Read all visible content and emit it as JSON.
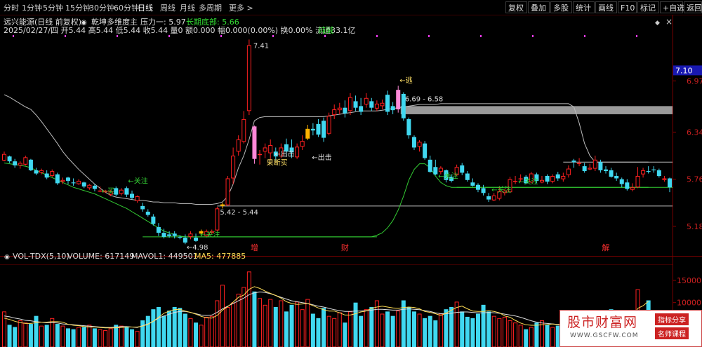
{
  "toolbar": {
    "periods": [
      "分时",
      "1分钟",
      "5分钟",
      "15分钟",
      "30分钟",
      "60分钟",
      "日线",
      "周线",
      "月线",
      "多周期",
      "更多 >"
    ],
    "active_period": "日线",
    "right_buttons": [
      "复权",
      "叠加",
      "多股",
      "统计",
      "画线",
      "F10",
      "标记",
      "+自选",
      "返回"
    ]
  },
  "info": {
    "title": "远兴能源(日线 前复权)",
    "indicator": "乾坤多维度主",
    "pressure_label": "压力一: 5.97",
    "bottom_label": "长期底部: 5.66",
    "quote": "2025/02/27/四 开5.44 高5.44 低5.44 收5.44 量0 额0.000 幅0.000(0.00%) 换0.00% 流通33.1亿",
    "tag": "纯碱"
  },
  "vol_header": {
    "name": "VOL-TDX(5,10)",
    "volume": "VOLUME: 617149",
    "mavol1": "MAVOL1: 449501",
    "ma5": "MA5: 477885"
  },
  "chart_data": {
    "type": "candlestick",
    "price_axis_ticks": [
      "7.10",
      "6.97",
      "6.34",
      "5.76",
      "5.18"
    ],
    "volume_axis_ticks": [
      "15000",
      "10000"
    ],
    "ylim": [
      4.98,
      7.44
    ],
    "candles": [
      [
        5.99,
        6.07,
        6.1,
        5.98
      ],
      [
        6.04,
        5.98,
        6.05,
        5.96
      ],
      [
        5.98,
        5.93,
        6.01,
        5.9
      ],
      [
        5.93,
        5.96,
        5.98,
        5.89
      ],
      [
        5.94,
        6.03,
        6.05,
        5.93
      ],
      [
        6.0,
        5.87,
        6.01,
        5.86
      ],
      [
        5.87,
        5.83,
        5.9,
        5.81
      ],
      [
        5.84,
        5.87,
        5.89,
        5.82
      ],
      [
        5.83,
        5.78,
        5.87,
        5.76
      ],
      [
        5.8,
        5.86,
        5.88,
        5.79
      ],
      [
        5.82,
        5.71,
        5.84,
        5.69
      ],
      [
        5.73,
        5.75,
        5.78,
        5.7
      ],
      [
        5.78,
        5.74,
        5.79,
        5.7
      ],
      [
        5.72,
        5.71,
        5.77,
        5.68
      ],
      [
        5.7,
        5.74,
        5.76,
        5.69
      ],
      [
        5.72,
        5.67,
        5.73,
        5.65
      ],
      [
        5.65,
        5.69,
        5.7,
        5.63
      ],
      [
        5.68,
        5.64,
        5.7,
        5.61
      ],
      [
        5.62,
        5.62,
        5.67,
        5.6
      ],
      [
        5.6,
        5.62,
        5.63,
        5.59
      ],
      [
        5.57,
        5.61,
        5.63,
        5.55
      ],
      [
        5.65,
        5.57,
        5.67,
        5.55
      ],
      [
        5.58,
        5.63,
        5.65,
        5.56
      ],
      [
        5.65,
        5.57,
        5.67,
        5.54
      ],
      [
        5.58,
        5.53,
        5.62,
        5.51
      ],
      [
        5.49,
        5.55,
        5.56,
        5.47
      ],
      [
        5.43,
        5.39,
        5.47,
        5.36
      ],
      [
        5.36,
        5.32,
        5.39,
        5.3
      ],
      [
        5.3,
        5.21,
        5.33,
        5.19
      ],
      [
        5.17,
        5.1,
        5.22,
        5.06
      ],
      [
        5.1,
        5.05,
        5.15,
        5.03
      ],
      [
        5.08,
        5.06,
        5.12,
        5.04
      ],
      [
        5.09,
        5.06,
        5.12,
        5.03
      ],
      [
        5.05,
        5.04,
        5.07,
        5.02
      ],
      [
        5.04,
        4.98,
        5.08,
        4.96
      ],
      [
        5.05,
        5.09,
        5.12,
        5.02
      ],
      [
        5.04,
        5.0,
        5.09,
        4.99
      ],
      [
        5.09,
        5.12,
        5.14,
        5.06
      ],
      [
        5.06,
        5.12,
        5.14,
        5.05
      ],
      [
        5.1,
        5.12,
        5.14,
        5.08
      ],
      [
        5.13,
        5.4,
        5.42,
        5.12
      ],
      [
        5.43,
        5.45,
        5.47,
        5.4
      ],
      [
        5.44,
        5.77,
        5.8,
        5.43
      ],
      [
        5.77,
        6.05,
        6.15,
        5.7
      ],
      [
        6.1,
        6.25,
        6.3,
        6.05
      ],
      [
        6.22,
        6.5,
        6.6,
        6.2
      ],
      [
        6.6,
        7.41,
        7.48,
        6.55
      ],
      [
        6.41,
        6.01,
        6.42,
        5.95
      ],
      [
        6.06,
        6.07,
        6.12,
        5.94
      ],
      [
        6.1,
        6.15,
        6.2,
        6.02
      ],
      [
        6.08,
        6.18,
        6.25,
        6.0
      ],
      [
        6.1,
        6.04,
        6.15,
        5.99
      ],
      [
        6.04,
        6.15,
        6.2,
        6.02
      ],
      [
        6.19,
        6.1,
        6.26,
        6.05
      ],
      [
        6.15,
        6.09,
        6.25,
        6.02
      ],
      [
        6.03,
        6.16,
        6.2,
        6.01
      ],
      [
        6.16,
        6.23,
        6.3,
        6.12
      ],
      [
        6.26,
        6.38,
        6.43,
        6.24
      ],
      [
        6.38,
        6.36,
        6.45,
        6.3
      ],
      [
        6.44,
        6.31,
        6.5,
        6.28
      ],
      [
        6.48,
        6.27,
        6.52,
        6.22
      ],
      [
        6.32,
        6.54,
        6.58,
        6.3
      ],
      [
        6.55,
        6.62,
        6.68,
        6.5
      ],
      [
        6.61,
        6.64,
        6.7,
        6.56
      ],
      [
        6.64,
        6.57,
        6.73,
        6.52
      ],
      [
        6.6,
        6.77,
        6.82,
        6.55
      ],
      [
        6.72,
        6.64,
        6.79,
        6.6
      ],
      [
        6.66,
        6.59,
        6.76,
        6.55
      ],
      [
        6.68,
        6.76,
        6.82,
        6.64
      ],
      [
        6.72,
        6.64,
        6.76,
        6.6
      ],
      [
        6.63,
        6.69,
        6.73,
        6.6
      ],
      [
        6.66,
        6.7,
        6.74,
        6.62
      ],
      [
        6.8,
        6.59,
        6.85,
        6.55
      ],
      [
        6.66,
        6.61,
        6.71,
        6.56
      ],
      [
        6.62,
        6.86,
        6.91,
        6.58
      ],
      [
        6.81,
        6.51,
        6.83,
        6.48
      ],
      [
        6.5,
        6.3,
        6.52,
        6.26
      ],
      [
        6.28,
        6.15,
        6.3,
        6.12
      ],
      [
        6.16,
        6.22,
        6.24,
        6.1
      ],
      [
        6.2,
        6.02,
        6.23,
        6.0
      ],
      [
        6.0,
        5.85,
        6.05,
        5.84
      ],
      [
        5.91,
        5.82,
        6.0,
        5.81
      ],
      [
        5.85,
        5.9,
        5.92,
        5.82
      ],
      [
        5.87,
        5.75,
        5.88,
        5.72
      ],
      [
        5.79,
        5.74,
        5.82,
        5.72
      ],
      [
        5.81,
        5.91,
        5.94,
        5.8
      ],
      [
        5.93,
        5.84,
        5.96,
        5.81
      ],
      [
        5.83,
        5.75,
        5.86,
        5.73
      ],
      [
        5.72,
        5.68,
        5.77,
        5.67
      ],
      [
        5.69,
        5.63,
        5.71,
        5.6
      ],
      [
        5.65,
        5.59,
        5.69,
        5.56
      ],
      [
        5.55,
        5.51,
        5.59,
        5.48
      ],
      [
        5.5,
        5.56,
        5.59,
        5.49
      ],
      [
        5.52,
        5.61,
        5.67,
        5.5
      ],
      [
        5.59,
        5.62,
        5.64,
        5.56
      ],
      [
        5.6,
        5.76,
        5.79,
        5.59
      ],
      [
        5.73,
        5.74,
        5.8,
        5.7
      ],
      [
        5.77,
        5.77,
        5.82,
        5.73
      ],
      [
        5.79,
        5.71,
        5.81,
        5.7
      ],
      [
        5.72,
        5.83,
        5.85,
        5.71
      ],
      [
        5.82,
        5.74,
        5.84,
        5.71
      ],
      [
        5.72,
        5.75,
        5.8,
        5.71
      ],
      [
        5.8,
        5.73,
        5.82,
        5.7
      ],
      [
        5.73,
        5.8,
        5.82,
        5.71
      ],
      [
        5.82,
        5.77,
        5.85,
        5.74
      ],
      [
        5.76,
        5.8,
        5.84,
        5.73
      ],
      [
        5.81,
        5.89,
        5.93,
        5.78
      ],
      [
        5.99,
        5.97,
        6.01,
        5.9
      ],
      [
        5.95,
        5.96,
        6.02,
        5.92
      ],
      [
        5.92,
        5.86,
        5.96,
        5.84
      ],
      [
        5.88,
        5.9,
        5.95,
        5.87
      ],
      [
        5.89,
        6.0,
        6.05,
        5.86
      ],
      [
        5.97,
        5.87,
        6.0,
        5.84
      ],
      [
        5.88,
        5.86,
        5.92,
        5.83
      ],
      [
        5.87,
        5.79,
        5.9,
        5.78
      ],
      [
        5.8,
        5.77,
        5.84,
        5.74
      ],
      [
        5.76,
        5.7,
        5.78,
        5.66
      ],
      [
        5.72,
        5.64,
        5.76,
        5.62
      ],
      [
        5.63,
        5.66,
        5.71,
        5.61
      ],
      [
        5.66,
        5.8,
        5.91,
        5.65
      ],
      [
        5.82,
        5.87,
        5.9,
        5.78
      ],
      [
        5.86,
        5.85,
        5.92,
        5.83
      ],
      [
        5.88,
        5.87,
        5.92,
        5.84
      ],
      [
        5.87,
        5.8,
        5.89,
        5.78
      ],
      [
        5.75,
        5.77,
        5.8,
        5.73
      ],
      [
        5.77,
        5.66,
        5.78,
        5.6
      ]
    ],
    "highlight_candles": {
      "pink": [
        47,
        74
      ],
      "orange": [
        37,
        41,
        57
      ]
    },
    "volumes": [
      8000,
      5000,
      4500,
      6000,
      5500,
      5200,
      7000,
      4800,
      5000,
      6500,
      5200,
      4800,
      4200,
      4000,
      4500,
      4500,
      5000,
      4200,
      4000,
      3800,
      4200,
      5000,
      4800,
      4600,
      4000,
      3600,
      6000,
      7000,
      8500,
      9000,
      7000,
      8200,
      9000,
      8800,
      7500,
      6500,
      5500,
      5000,
      6800,
      7000,
      10500,
      14000,
      9000,
      10000,
      12000,
      13500,
      17000,
      12500,
      11000,
      9500,
      10800,
      9000,
      10500,
      8000,
      9500,
      10200,
      8500,
      10800,
      7500,
      6500,
      8800,
      7000,
      6500,
      7800,
      5500,
      8000,
      10000,
      7000,
      8500,
      9000,
      10500,
      7500,
      8000,
      7000,
      8200,
      10500,
      9000,
      8000,
      7500,
      6500,
      7000,
      6000,
      7500,
      8500,
      9000,
      10200,
      8000,
      6800,
      6500,
      7500,
      9500,
      8000,
      7000,
      6500,
      6800,
      6000,
      5500,
      5000,
      4000,
      4500,
      5500,
      6000,
      5000,
      4500,
      4800,
      5000,
      5000,
      4000,
      4200,
      5200,
      6000,
      5500,
      5200,
      5800,
      8500,
      6500,
      7000,
      5500,
      6500,
      13000,
      8000,
      10500
    ],
    "mavol1": [
      7000,
      6800,
      6500,
      6300,
      6000,
      5900,
      5700,
      5600,
      5500,
      5500,
      5400,
      5200,
      5100,
      5000,
      4900,
      4800,
      4700,
      4600,
      4500,
      4400,
      4400,
      4500,
      4600,
      4600,
      4500,
      4400,
      4800,
      5200,
      5800,
      6500,
      7000,
      7400,
      7800,
      8000,
      8000,
      7800,
      7500,
      7200,
      7100,
      7200,
      7800,
      8600,
      9200,
      9800,
      10400,
      11000,
      11800,
      12200,
      12400,
      12300,
      12000,
      11600,
      11200,
      10800,
      10400,
      10200,
      10000,
      9800,
      9500,
      9200,
      9000,
      8700,
      8400,
      8200,
      8000,
      8000,
      8100,
      8100,
      8200,
      8300,
      8500,
      8500,
      8400,
      8300,
      8300,
      8500,
      8600,
      8500,
      8400,
      8200,
      8000,
      7700,
      7500,
      7500,
      7600,
      7800,
      7900,
      7900,
      7800,
      7700,
      7700,
      7800,
      7700,
      7600,
      7400,
      7200,
      7000,
      6700,
      6300,
      5900,
      5600,
      5400,
      5300,
      5200,
      5100,
      5000,
      4900,
      4800,
      4700,
      4700,
      4800,
      4900,
      5000,
      5100,
      5500,
      5700,
      5900,
      6000,
      6100,
      6600,
      6900,
      7300
    ],
    "ma5": [
      6500,
      6200,
      5800,
      5500,
      5300,
      5300,
      5500,
      5600,
      5600,
      5700,
      5700,
      5600,
      5100,
      4900,
      4800,
      4600,
      4500,
      4500,
      4400,
      4300,
      4300,
      4300,
      4400,
      4500,
      4500,
      4500,
      4700,
      5100,
      5800,
      6700,
      7600,
      8100,
      8400,
      8500,
      8100,
      7800,
      7400,
      6900,
      6600,
      6500,
      7100,
      8300,
      9100,
      10100,
      11200,
      11700,
      13000,
      13600,
      13200,
      12600,
      12100,
      11600,
      11000,
      10200,
      9800,
      9600,
      9700,
      9800,
      9300,
      8800,
      8400,
      8100,
      8100,
      7700,
      7200,
      7200,
      7500,
      7900,
      8100,
      8700,
      9000,
      9200,
      9000,
      8800,
      8700,
      8900,
      9000,
      8900,
      8600,
      8000,
      7800,
      7500,
      7100,
      7600,
      8300,
      8900,
      9200,
      8600,
      8100,
      8000,
      8000,
      8200,
      8000,
      7700,
      7000,
      6700,
      6000,
      5400,
      5000,
      4900,
      4900,
      5000,
      5000,
      5200,
      5000,
      4800,
      4900,
      4800,
      4500,
      4500,
      4800,
      5100,
      5300,
      5500,
      6200,
      6500,
      6800,
      6500,
      6700,
      8700,
      9300,
      10300
    ],
    "ceiling_line": [
      6.8,
      6.77,
      6.73,
      6.69,
      6.65,
      6.62,
      6.55,
      6.47,
      6.38,
      6.29,
      6.2,
      6.1,
      6.02,
      5.95,
      5.88,
      5.82,
      5.76,
      5.7,
      5.65,
      5.6,
      5.56,
      5.54,
      5.53,
      5.52,
      5.51,
      5.5,
      5.5,
      5.49,
      5.48,
      5.48,
      5.47,
      5.47,
      5.47,
      5.46,
      5.46,
      5.46,
      5.45,
      5.45,
      5.45,
      5.45,
      5.46,
      5.48,
      5.55,
      5.7,
      5.9,
      6.05,
      6.25,
      6.48,
      6.52,
      6.53,
      6.53,
      6.53,
      6.53,
      6.53,
      6.53,
      6.53,
      6.53,
      6.53,
      6.53,
      6.53,
      6.53,
      6.54,
      6.55,
      6.56,
      6.57,
      6.58,
      6.59,
      6.6,
      6.6,
      6.6,
      6.6,
      6.61,
      6.62,
      6.63,
      6.64,
      6.65,
      6.66,
      6.67,
      6.68,
      6.68,
      6.68,
      6.68,
      6.69,
      6.69,
      6.69,
      6.69,
      6.69,
      6.69,
      6.69,
      6.69,
      6.69,
      6.69,
      6.69,
      6.69,
      6.69,
      6.69,
      6.69,
      6.69,
      6.69,
      6.69,
      6.69,
      6.69,
      6.69,
      6.69,
      6.69,
      6.69,
      6.69,
      6.65,
      6.45,
      6.2,
      6.05,
      5.97,
      5.97,
      5.97,
      5.97,
      5.97,
      5.97,
      5.97,
      5.97,
      5.97,
      5.97,
      5.97
    ],
    "support_line": [
      5.96,
      5.96,
      5.96,
      5.96,
      5.96,
      5.96,
      5.96,
      5.96,
      5.96,
      5.96,
      5.96,
      5.96,
      5.96,
      5.96,
      5.96,
      5.96,
      5.96,
      5.96,
      5.96,
      5.96,
      5.96,
      5.96,
      5.96,
      5.96,
      5.96,
      5.96,
      5.96,
      5.96,
      5.96,
      5.96,
      5.96,
      5.96,
      5.96,
      5.96,
      5.96,
      5.96,
      5.96,
      5.96,
      5.96,
      5.96,
      5.96,
      5.96,
      5.96,
      5.96,
      5.96,
      5.96,
      5.96,
      5.96,
      5.96,
      5.96,
      5.96,
      5.96,
      5.96,
      5.96,
      5.96,
      5.96,
      5.96,
      5.96,
      5.96,
      5.96,
      5.96,
      5.96,
      5.96,
      5.96,
      5.96,
      5.96,
      5.96,
      5.96,
      5.96,
      5.96,
      5.96,
      5.96,
      5.96,
      5.96,
      5.96,
      5.96,
      5.96,
      5.96,
      5.96,
      5.96,
      5.96,
      5.96,
      5.96,
      5.96,
      5.96,
      5.96,
      5.96,
      5.96,
      5.96,
      5.96,
      5.96,
      5.96,
      5.96,
      5.96,
      5.96,
      5.96,
      5.96,
      5.96,
      5.96,
      5.96,
      5.96,
      5.96,
      5.96,
      5.96,
      5.96,
      5.96,
      5.96,
      5.96,
      5.96,
      5.96,
      5.96,
      5.96,
      5.96,
      5.96,
      5.96,
      5.96,
      5.96,
      5.96,
      5.96,
      5.96
    ],
    "bottom_green_line": [
      5.96,
      5.95,
      5.94,
      5.93,
      5.92,
      5.9,
      5.87,
      5.84,
      5.81,
      5.78,
      5.75,
      5.72,
      5.69,
      5.66,
      5.64,
      5.62,
      5.6,
      5.58,
      5.55,
      5.52,
      5.49,
      5.46,
      5.43,
      5.4,
      5.36,
      5.32,
      5.28,
      5.24,
      5.2,
      5.16,
      5.12,
      5.1,
      5.08,
      5.06,
      5.05,
      5.05,
      5.05,
      5.05,
      5.05,
      5.05,
      5.05,
      5.05,
      5.05,
      5.05,
      5.05,
      5.05,
      5.05,
      5.05,
      5.05,
      5.05,
      5.05,
      5.05,
      5.05,
      5.05,
      5.05,
      5.05,
      5.05,
      5.05,
      5.05,
      5.05,
      5.05,
      5.05,
      5.05,
      5.05,
      5.05,
      5.05,
      5.05,
      5.05,
      5.05,
      5.05,
      5.07,
      5.1,
      5.16,
      5.25,
      5.38,
      5.55,
      5.75,
      5.88,
      5.95,
      5.95,
      5.9,
      5.8,
      5.72,
      5.68,
      5.66,
      5.66,
      5.66,
      5.66,
      5.66,
      5.66,
      5.66,
      5.66,
      5.66,
      5.66,
      5.66,
      5.66,
      5.66,
      5.66,
      5.66,
      5.66,
      5.66,
      5.66,
      5.66,
      5.66,
      5.66,
      5.66,
      5.66,
      5.66,
      5.66,
      5.66,
      5.66,
      5.66,
      5.66,
      5.66,
      5.66,
      5.66,
      5.66,
      5.66,
      5.66,
      5.66,
      5.66,
      5.66
    ],
    "levels": [
      {
        "label": "5.42 - 5.44",
        "value": 5.43
      },
      {
        "label": "6.69 - 6.58",
        "value": 6.64
      }
    ],
    "annotations": [
      "7.41",
      "←逃",
      "←出击",
      "←出击",
      "果断买",
      "←买",
      "←关注",
      "←关注",
      "←关注",
      "←关注",
      "←关注",
      "←4.98"
    ],
    "events": [
      "增",
      "财",
      "解"
    ]
  },
  "watermark": {
    "logo": "股市财富网",
    "url": "WWW.GSCFW.COM",
    "tag1": "指标分享",
    "tag2": "名师课程"
  }
}
